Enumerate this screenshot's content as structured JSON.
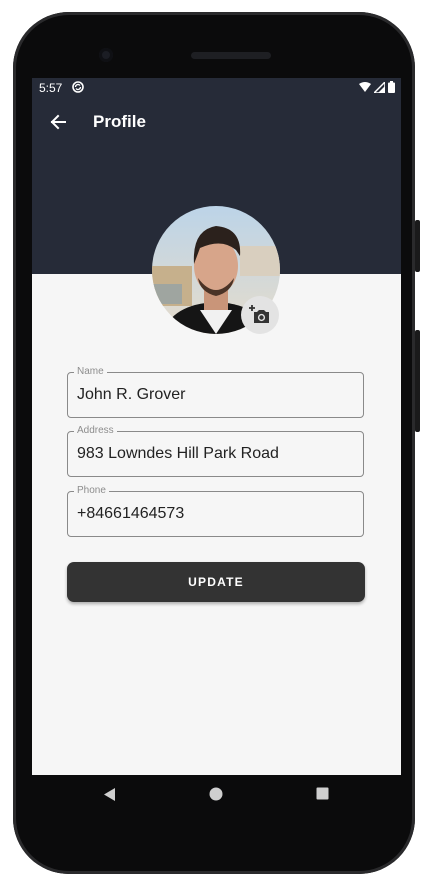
{
  "status_bar": {
    "time": "5:57"
  },
  "app_bar": {
    "title": "Profile"
  },
  "form": {
    "name": {
      "label": "Name",
      "value": "John R. Grover"
    },
    "address": {
      "label": "Address",
      "value": "983 Lowndes Hill Park Road"
    },
    "phone": {
      "label": "Phone",
      "value": "+84661464573"
    }
  },
  "update_button": {
    "label": "UPDATE"
  },
  "colors": {
    "header": "#262b38",
    "screen_bg": "#f6f6f6",
    "button": "#333333"
  },
  "icons": [
    "back-arrow-icon",
    "add-photo-icon",
    "wifi-icon",
    "signal-icon",
    "battery-icon",
    "sync-icon",
    "nav-back-icon",
    "nav-home-icon",
    "nav-recents-icon"
  ]
}
